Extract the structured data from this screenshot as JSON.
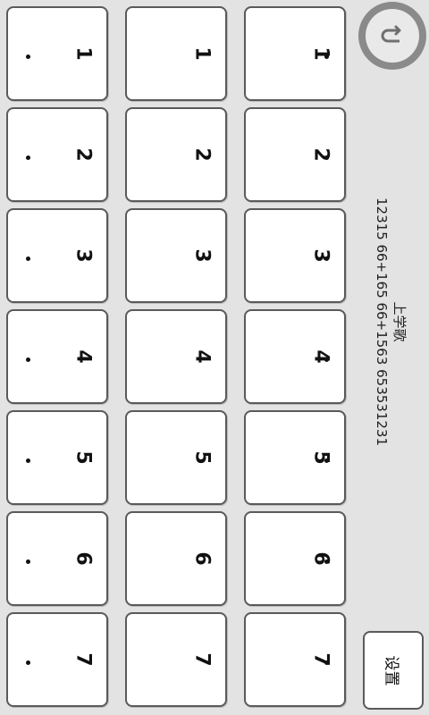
{
  "app": {
    "song_title": "上学歌",
    "notation": "12315 66+165 66+1563 653531231",
    "settings_label": "设置",
    "back_icon": "back-arrow-icon"
  },
  "keyboard": {
    "columns": [
      {
        "octave": "high",
        "keys": [
          "1",
          "2",
          "3",
          "4",
          "5",
          "6",
          "7"
        ]
      },
      {
        "octave": "middle",
        "keys": [
          "1",
          "2",
          "3",
          "4",
          "5",
          "6",
          "7"
        ]
      },
      {
        "octave": "low",
        "keys": [
          "1",
          "2",
          "3",
          "4",
          "5",
          "6",
          "7"
        ]
      }
    ]
  },
  "colors": {
    "background": "#e3e3e3",
    "key_fill": "#ffffff",
    "key_border": "#5a5a5a",
    "text": "#111111"
  }
}
